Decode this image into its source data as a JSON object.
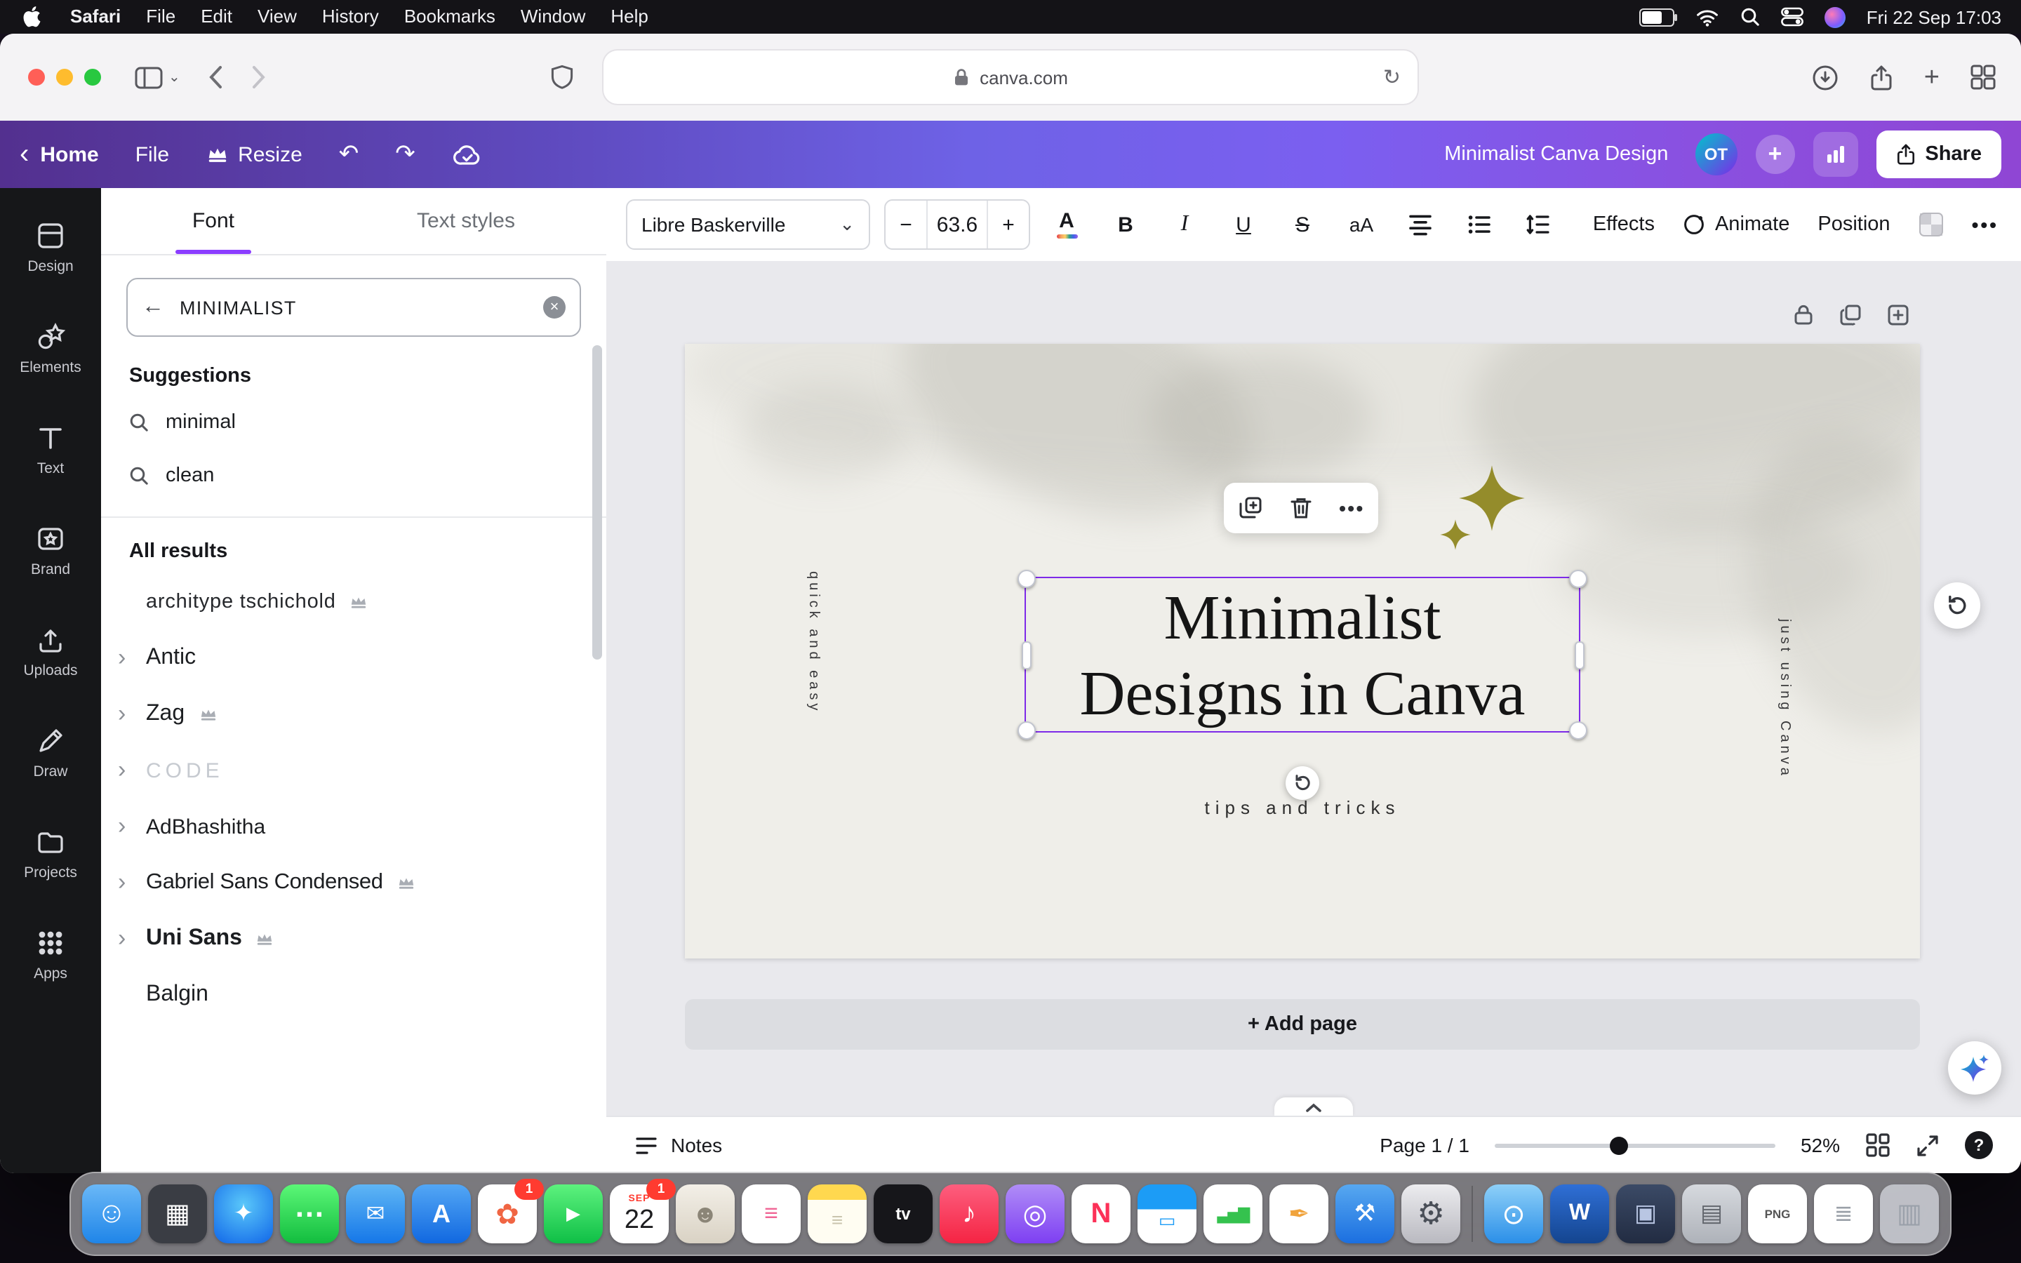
{
  "colors": {
    "accent": "#8b3dff",
    "selection": "#7d2ae8",
    "sparkle": "#948c2b",
    "badge": "#ff3b30"
  },
  "menubar": {
    "items": [
      {
        "label": "Safari"
      },
      {
        "label": "File"
      },
      {
        "label": "Edit"
      },
      {
        "label": "View"
      },
      {
        "label": "History"
      },
      {
        "label": "Bookmarks"
      },
      {
        "label": "Window"
      },
      {
        "label": "Help"
      }
    ],
    "clock": "Fri 22 Sep 17:03"
  },
  "safari": {
    "url": "canva.com"
  },
  "header": {
    "home": "Home",
    "file": "File",
    "resize": "Resize",
    "title": "Minimalist Canva Design",
    "avatar": "OT",
    "share": "Share"
  },
  "rail": {
    "items": [
      {
        "label": "Design"
      },
      {
        "label": "Elements"
      },
      {
        "label": "Text"
      },
      {
        "label": "Brand"
      },
      {
        "label": "Uploads"
      },
      {
        "label": "Draw"
      },
      {
        "label": "Projects"
      },
      {
        "label": "Apps"
      }
    ]
  },
  "panel": {
    "tab_font": "Font",
    "tab_styles": "Text styles",
    "search_value": "MINIMALIST",
    "suggestions_title": "Suggestions",
    "suggestions": [
      {
        "label": "minimal"
      },
      {
        "label": "clean"
      }
    ],
    "results_title": "All results",
    "fonts": [
      {
        "name": "architype tschichold",
        "premium": true
      },
      {
        "name": "Antic",
        "premium": false
      },
      {
        "name": "Zag",
        "premium": true
      },
      {
        "name": "CODE",
        "premium": false
      },
      {
        "name": "AdBhashitha",
        "premium": false
      },
      {
        "name": "Gabriel Sans Condensed",
        "premium": true
      },
      {
        "name": "Uni Sans",
        "premium": true
      },
      {
        "name": "Balgin",
        "premium": false
      }
    ]
  },
  "toolbar": {
    "font_name": "Libre Baskerville",
    "size": "63.6",
    "minus": "−",
    "plus": "+",
    "color": "A",
    "bold": "B",
    "italic": "I",
    "underline": "U",
    "strike": "S",
    "case": "aA",
    "effects": "Effects",
    "animate": "Animate",
    "position": "Position",
    "more": "•••"
  },
  "canvas": {
    "side_left": "quick and easy",
    "side_right": "just using Canva",
    "heading1": "Minimalist",
    "heading2": "Designs in Canva",
    "tips": "tips and tricks",
    "add_page": "+ Add page",
    "float_more": "•••"
  },
  "statusbar": {
    "notes": "Notes",
    "page": "Page 1 / 1",
    "zoom": "52%",
    "help": "?"
  },
  "icons": {
    "caret_left": "‹",
    "back_arrow": "←",
    "clear": "×",
    "chevron_down": "⌄",
    "chevron_right": "›",
    "undo": "↶",
    "redo": "↷",
    "reload": "↻",
    "plus": "+"
  },
  "dock": {
    "items": [
      {
        "name": "finder",
        "glyph": "☺"
      },
      {
        "name": "launchpad",
        "glyph": "▦"
      },
      {
        "name": "safari",
        "glyph": "✦"
      },
      {
        "name": "messages",
        "glyph": "…"
      },
      {
        "name": "mail",
        "glyph": "✉"
      },
      {
        "name": "app-store",
        "glyph": "A"
      },
      {
        "name": "photos",
        "glyph": "✿",
        "badge": "1"
      },
      {
        "name": "facetime",
        "glyph": "▶"
      },
      {
        "name": "calendar",
        "month": "SEP",
        "day": "22",
        "badge": "1"
      },
      {
        "name": "contacts",
        "glyph": "☻"
      },
      {
        "name": "reminders",
        "glyph": "≡"
      },
      {
        "name": "notes",
        "glyph": "≡"
      },
      {
        "name": "tv",
        "glyph": "tv"
      },
      {
        "name": "music",
        "glyph": "♪"
      },
      {
        "name": "podcasts",
        "glyph": "◎"
      },
      {
        "name": "news",
        "glyph": "N"
      },
      {
        "name": "keynote",
        "glyph": "▭"
      },
      {
        "name": "numbers",
        "glyph": "▃▅▇"
      },
      {
        "name": "pages",
        "glyph": "✒"
      },
      {
        "name": "xcode",
        "glyph": "⚒"
      },
      {
        "name": "settings",
        "glyph": "⚙"
      },
      {
        "name": "preview",
        "glyph": "⊙"
      },
      {
        "name": "word",
        "glyph": "W"
      },
      {
        "name": "container",
        "glyph": "▣"
      },
      {
        "name": "archive",
        "glyph": "▤"
      },
      {
        "name": "png-file",
        "glyph": "PNG"
      },
      {
        "name": "text-file",
        "glyph": "≣"
      },
      {
        "name": "trash",
        "glyph": "▥"
      }
    ]
  }
}
